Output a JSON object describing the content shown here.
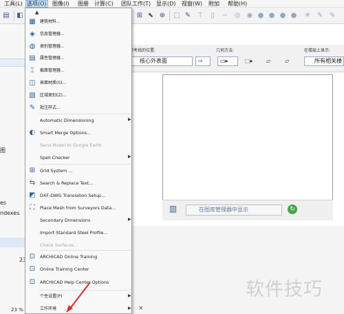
{
  "menubar": {
    "items": [
      {
        "label": "工具(L)"
      },
      {
        "label": "选项(O)",
        "active": true
      },
      {
        "label": "图像(I)"
      },
      {
        "label": "图册"
      },
      {
        "label": "计算(C)"
      },
      {
        "label": "团队工作(T)"
      },
      {
        "label": "显示(D)"
      },
      {
        "label": "视窗(W)"
      },
      {
        "label": "附加"
      },
      {
        "label": "帮助(H)"
      }
    ]
  },
  "infobox": {
    "ref_label": "参考线的位置:",
    "ref_value": "核心外表面",
    "geom_label": "几何方法:",
    "floor_label": "在楼层上显示:",
    "floor_value": "所有相关楼"
  },
  "library_button": {
    "label": "在图库管理器中显示"
  },
  "left_panel": {
    "row1": "图",
    "row2": "es",
    "row3": "ndexes",
    "row4": "23",
    "zoom": "23 %"
  },
  "dropdown": {
    "items": [
      {
        "label": "建筑材料...",
        "icon": "materials-icon",
        "disabled": false,
        "submenu": false
      },
      {
        "label": "信息管理器...",
        "icon": "tag-icon",
        "disabled": false,
        "submenu": false
      },
      {
        "label": "类别管理器...",
        "icon": "globe-icon",
        "disabled": false,
        "submenu": false
      },
      {
        "label": "属性管理器...",
        "icon": "property-icon",
        "disabled": false,
        "submenu": false
      },
      {
        "label": "截面管理器...",
        "icon": "profile-icon",
        "disabled": false,
        "submenu": false
      },
      {
        "label": "表面材质(S)...",
        "icon": "surface-icon",
        "disabled": false,
        "submenu": false
      },
      {
        "label": "区域类别(Z)...",
        "icon": "zone-icon",
        "disabled": false,
        "submenu": false
      },
      {
        "label": "批注样式...",
        "icon": "markup-icon",
        "disabled": false,
        "submenu": false
      },
      {
        "label": "Automatic Dimensioning",
        "icon": "",
        "disabled": false,
        "submenu": true
      },
      {
        "label": "Smart Merge Options...",
        "icon": "merge-icon",
        "disabled": false,
        "submenu": false
      },
      {
        "label": "Send Model to Google Earth",
        "icon": "",
        "disabled": true,
        "submenu": false
      },
      {
        "label": "Spell Checker",
        "icon": "",
        "disabled": false,
        "submenu": true
      },
      {
        "label": "Grid System ...",
        "icon": "grid-icon",
        "disabled": false,
        "submenu": false
      },
      {
        "label": "Search & Replace Text...",
        "icon": "search-replace-icon",
        "disabled": false,
        "submenu": false
      },
      {
        "label": "DXF-DWG Translation Setup...",
        "icon": "dxf-icon",
        "disabled": false,
        "submenu": false
      },
      {
        "label": "Place Mesh from Surveyors Data...",
        "icon": "mesh-icon",
        "disabled": false,
        "submenu": false
      },
      {
        "label": "Secondary Dimensions",
        "icon": "",
        "disabled": false,
        "submenu": true
      },
      {
        "label": "Import Standard Steel Profile...",
        "icon": "",
        "disabled": false,
        "submenu": false
      },
      {
        "label": "Check Surfaces...",
        "icon": "",
        "disabled": true,
        "submenu": false
      },
      {
        "label": "ARCHICAD Online Training",
        "icon": "training-icon",
        "disabled": false,
        "submenu": false
      },
      {
        "label": "Online Training Center",
        "icon": "training-icon",
        "disabled": false,
        "submenu": false
      },
      {
        "label": "ARCHICAD Help Center Options",
        "icon": "training-icon",
        "disabled": false,
        "submenu": false
      },
      {
        "label": "个性设置(P)",
        "icon": "",
        "disabled": false,
        "submenu": true
      },
      {
        "label": "工作环境",
        "icon": "",
        "disabled": false,
        "submenu": true
      }
    ]
  },
  "watermark": "软件技巧",
  "colors": {
    "menu_highlight": "#cde6f7",
    "arrow": "#e0312b",
    "icon_blue": "#2f5d99"
  }
}
